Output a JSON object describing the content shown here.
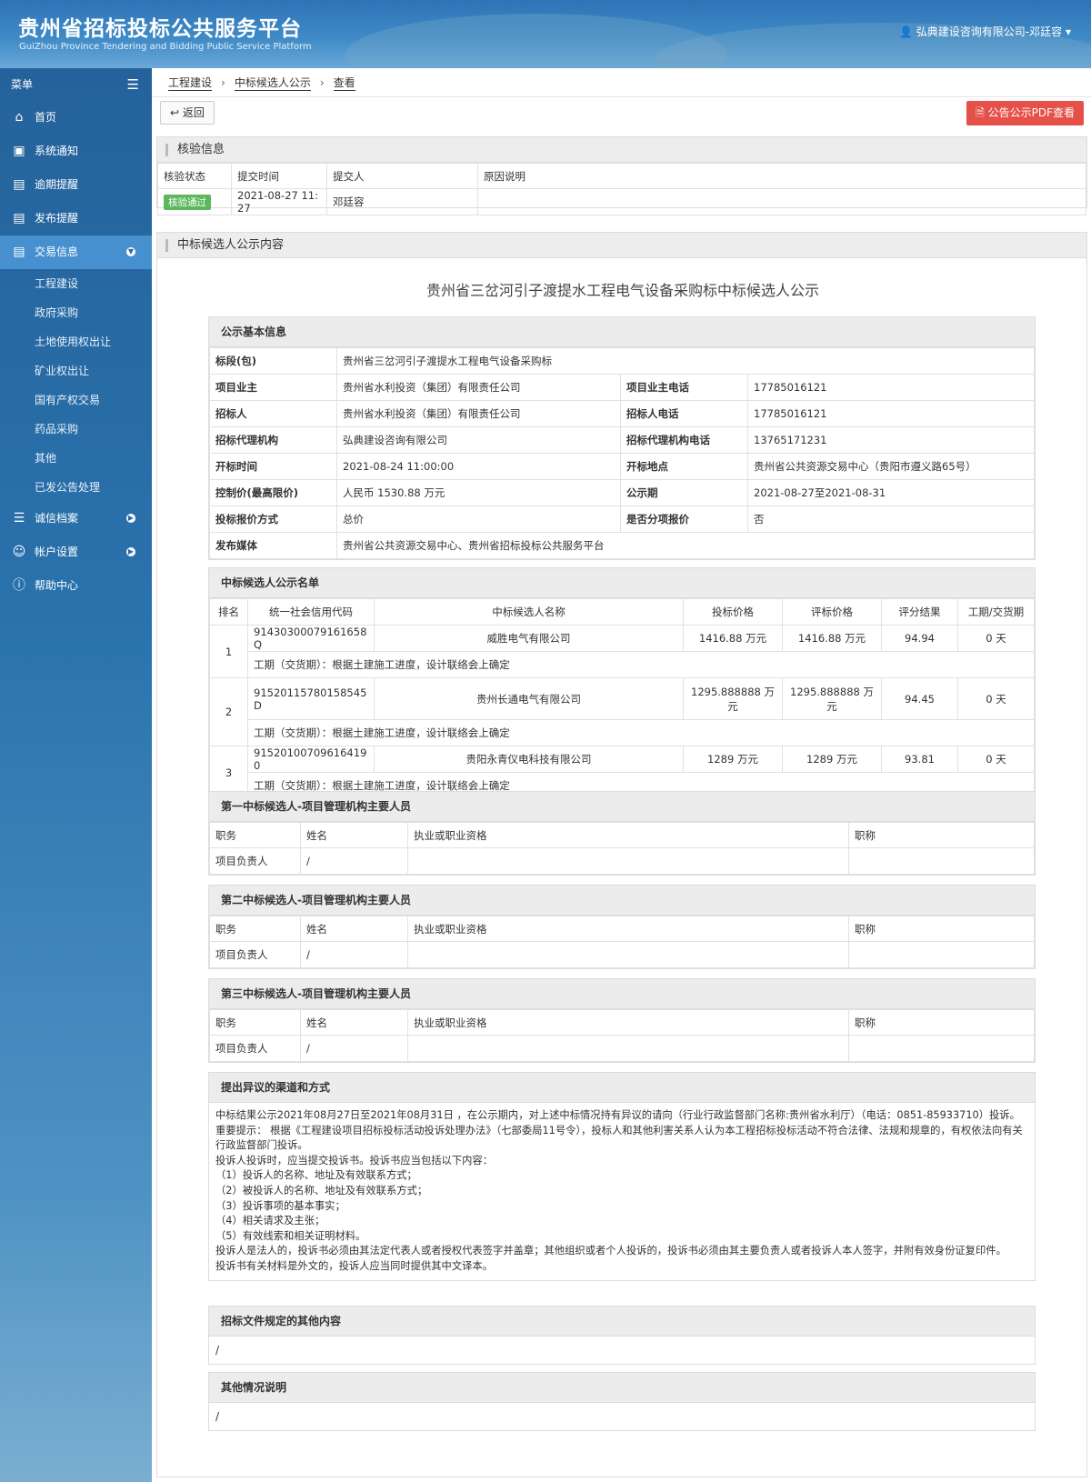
{
  "header": {
    "title_cn": "贵州省招标投标公共服务平台",
    "title_en": "GuiZhou Province Tendering and Bidding Public Service Platform",
    "user": "弘典建设咨询有限公司-邓廷容"
  },
  "sidebar": {
    "menu_label": "菜单",
    "items": [
      {
        "label": "首页",
        "icon": "home-icon"
      },
      {
        "label": "系统通知",
        "icon": "monitor-icon"
      },
      {
        "label": "逾期提醒",
        "icon": "notice-icon"
      },
      {
        "label": "发布提醒",
        "icon": "notice-icon"
      },
      {
        "label": "交易信息",
        "icon": "notice-icon"
      }
    ],
    "sub_items": [
      "工程建设",
      "政府采购",
      "土地使用权出让",
      "矿业权出让",
      "国有产权交易",
      "药品采购",
      "其他",
      "已发公告处理"
    ],
    "items_after": [
      {
        "label": "诚信档案",
        "icon": "list-icon"
      },
      {
        "label": "帐户设置",
        "icon": "user-icon"
      },
      {
        "label": "帮助中心",
        "icon": "help-icon"
      }
    ]
  },
  "breadcrumb": {
    "items": [
      "工程建设",
      "中标候选人公示",
      "查看"
    ]
  },
  "toolbar": {
    "back_label": "返回",
    "pdf_label": "公告公示PDF查看"
  },
  "check_panel": {
    "title": "核验信息",
    "headers": [
      "核验状态",
      "提交时间",
      "提交人",
      "原因说明"
    ],
    "row": {
      "status": "核验通过",
      "time": "2021-08-27 11:27",
      "submitter": "邓廷容",
      "reason": ""
    }
  },
  "content_panel": {
    "title": "中标候选人公示内容"
  },
  "doc_title": "贵州省三岔河引子渡提水工程电气设备采购标中标候选人公示",
  "basic": {
    "title": "公示基本信息",
    "section_label": "标段(包)",
    "section_value": "贵州省三岔河引子渡提水工程电气设备采购标",
    "rows": [
      {
        "k1": "项目业主",
        "v1": "贵州省水利投资（集团）有限责任公司",
        "k2": "项目业主电话",
        "v2": "17785016121"
      },
      {
        "k1": "招标人",
        "v1": "贵州省水利投资（集团）有限责任公司",
        "k2": "招标人电话",
        "v2": "17785016121"
      },
      {
        "k1": "招标代理机构",
        "v1": "弘典建设咨询有限公司",
        "k2": "招标代理机构电话",
        "v2": "13765171231"
      },
      {
        "k1": "开标时间",
        "v1": "2021-08-24 11:00:00",
        "k2": "开标地点",
        "v2": "贵州省公共资源交易中心（贵阳市遵义路65号）"
      },
      {
        "k1": "控制价(最高限价)",
        "v1": "人民币 1530.88 万元",
        "k2": "公示期",
        "v2": "2021-08-27至2021-08-31"
      },
      {
        "k1": "投标报价方式",
        "v1": "总价",
        "k2": "是否分项报价",
        "v2": "否"
      }
    ],
    "media_label": "发布媒体",
    "media_value": "贵州省公共资源交易中心、贵州省招标投标公共服务平台"
  },
  "candidates": {
    "title": "中标候选人公示名单",
    "headers": [
      "排名",
      "统一社会信用代码",
      "中标候选人名称",
      "投标价格",
      "评标价格",
      "评分结果",
      "工期/交货期"
    ],
    "rows": [
      {
        "rank": "1",
        "code": "91430300079161658Q",
        "name": "威胜电气有限公司",
        "bid": "1416.88 万元",
        "eval": "1416.88 万元",
        "score": "94.94",
        "period": "0 天",
        "note": "工期（交货期）：根据土建施工进度，设计联络会上确定"
      },
      {
        "rank": "2",
        "code": "91520115780158545D",
        "name": "贵州长通电气有限公司",
        "bid": "1295.888888 万元",
        "eval": "1295.888888 万元",
        "score": "94.45",
        "period": "0 天",
        "note": "工期（交货期）：根据土建施工进度，设计联络会上确定"
      },
      {
        "rank": "3",
        "code": "915201007096164190",
        "name": "贵阳永青仪电科技有限公司",
        "bid": "1289 万元",
        "eval": "1289 万元",
        "score": "93.81",
        "period": "0 天",
        "note": "工期（交货期）：根据土建施工进度，设计联络会上确定"
      }
    ]
  },
  "pm_sections": [
    {
      "title": "第一中标候选人-项目管理机构主要人员",
      "headers": [
        "职务",
        "姓名",
        "执业或职业资格",
        "职称"
      ],
      "row": [
        "项目负责人",
        "/",
        "",
        ""
      ]
    },
    {
      "title": "第二中标候选人-项目管理机构主要人员",
      "headers": [
        "职务",
        "姓名",
        "执业或职业资格",
        "职称"
      ],
      "row": [
        "项目负责人",
        "/",
        "",
        ""
      ]
    },
    {
      "title": "第三中标候选人-项目管理机构主要人员",
      "headers": [
        "职务",
        "姓名",
        "执业或职业资格",
        "职称"
      ],
      "row": [
        "项目负责人",
        "/",
        "",
        ""
      ]
    }
  ],
  "objection": {
    "title": "提出异议的渠道和方式",
    "lines": [
      "中标结果公示2021年08月27日至2021年08月31日 ，在公示期内，对上述中标情况持有异议的请向（行业行政监督部门名称:贵州省水利厅）（电话：0851-85933710）投诉。重要提示： 根据《工程建设项目招标投标活动投诉处理办法》（七部委局11号令），投标人和其他利害关系人认为本工程招标投标活动不符合法律、法规和规章的，有权依法向有关行政监督部门投诉。",
      "投诉人投诉时，应当提交投诉书。投诉书应当包括以下内容：",
      "（1）投诉人的名称、地址及有效联系方式；",
      "（2）被投诉人的名称、地址及有效联系方式；",
      "（3）投诉事项的基本事实；",
      "（4）相关请求及主张；",
      "（5）有效线索和相关证明材料。",
      "投诉人是法人的，投诉书必须由其法定代表人或者授权代表签字并盖章；其他组织或者个人投诉的，投诉书必须由其主要负责人或者投诉人本人签字，并附有效身份证复印件。",
      "投诉书有关材料是外文的，投诉人应当同时提供其中文译本。"
    ]
  },
  "other_content": {
    "title": "招标文件规定的其他内容",
    "value": "/"
  },
  "other_notes": {
    "title": "其他情况说明",
    "value": "/"
  }
}
